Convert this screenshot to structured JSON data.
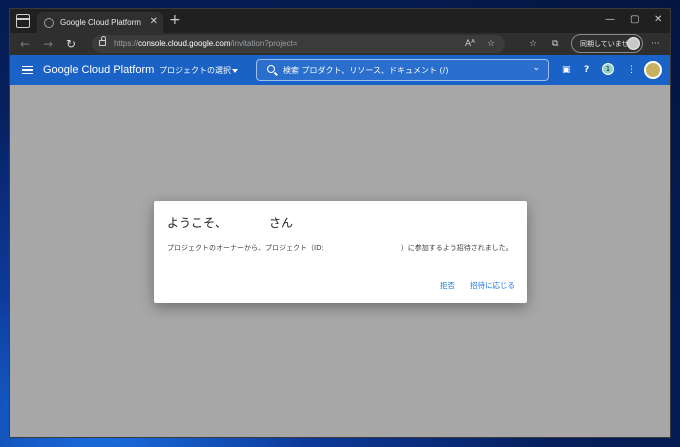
{
  "browser": {
    "tab_title": "Google Cloud Platform",
    "tab_close": "✕",
    "new_tab": "+",
    "win_min": "—",
    "win_max": "▢",
    "win_close": "✕",
    "back": "←",
    "forward": "→",
    "reload": "↻",
    "url_prefix": "https://",
    "url_domain": "console.cloud.google.com",
    "url_path": "/invitation?project=",
    "read_aloud": "Aᴬ",
    "favorite": "☆",
    "favorites": "☆",
    "collections": "⧉",
    "profile_label": "同期していません",
    "more": "···"
  },
  "gcp": {
    "logo": "Google Cloud Platform",
    "project_select": "プロジェクトの選択",
    "search_placeholder": "検索  プロダクト、リソース、ドキュメント (/)",
    "search_chevron": "⌄",
    "cloud_shell": "▣",
    "help": "?",
    "notifications": "1",
    "more": "⋮"
  },
  "dialog": {
    "title": "ようこそ、　　　　さん",
    "body": "プロジェクトのオーナーから、プロジェクト（ID:　　　　　　　　　　　）に参加するよう招待されました。",
    "decline": "拒否",
    "accept": "招待に応じる"
  },
  "colors": {
    "gcp_blue": "#1a62c6",
    "link_blue": "#1a73e8",
    "overlay_gray": "#a7a7a7"
  }
}
